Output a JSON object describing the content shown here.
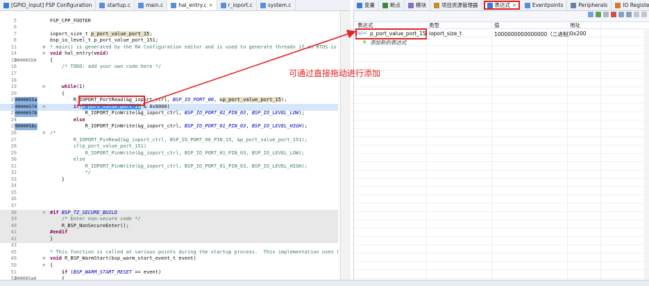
{
  "editor_tabs": [
    "[GPIO_input] FSP Configuration",
    "startup.c",
    "main.c",
    "hal_entry.c",
    "r_ioport.c",
    "system.c"
  ],
  "active_editor_tab": "hal_entry.c",
  "panel_tabs": [
    "变量",
    "断点",
    "模块",
    "项目资源管理器",
    "表达式",
    "Eventpoints",
    "Peripherals",
    "IO Registers"
  ],
  "active_panel_tab": "表达式",
  "expressions": {
    "columns": [
      "表达式",
      "类型",
      "值",
      "地址"
    ],
    "rows": [
      {
        "name": "p_port_value_port_15",
        "type": "ioport_size_t",
        "value": "1000000000000000（二进制）",
        "address": "0x200"
      }
    ],
    "add_new": "添加新的表达式"
  },
  "annotation": "可通过直接拖动进行添加",
  "code": {
    "top_line": "FSP_CPP_FOOTER",
    "lines": [
      {
        "n": "5",
        "addr": "",
        "text": ""
      },
      {
        "n": "6",
        "addr": "",
        "text": ""
      },
      {
        "n": "7",
        "addr": "",
        "text": "ioport_size_t p_port_value_port_15;"
      },
      {
        "n": "8",
        "addr": "",
        "text": "bsp_io_level_t p_port_value_port_151;"
      },
      {
        "n": "11",
        "addr": "",
        "text": "* main() is generated by the RA Configuration editor and is used to generate threads if an RTOS is"
      },
      {
        "n": "14",
        "addr": "",
        "text": "void hal_entry(void)"
      },
      {
        "n": "15",
        "addr": "00000550",
        "text": "{"
      },
      {
        "n": "16",
        "addr": "",
        "text": "    /* TODO: add your own code here */"
      },
      {
        "n": "17",
        "addr": "",
        "text": ""
      },
      {
        "n": "18",
        "addr": "",
        "text": ""
      },
      {
        "n": "19",
        "addr": "",
        "text": "    while(1)"
      },
      {
        "n": "20",
        "addr": "",
        "text": "    {"
      },
      {
        "n": "21",
        "addr": "0000055a",
        "text": "        R_IOPORT_PortRead(&g_ioport_ctrl, BSP_IO_PORT_00, &p_port_value_port_15);"
      },
      {
        "n": "22",
        "addr": "00000570",
        "text": "        if(p_port_value_port_15 & 0x8000)"
      },
      {
        "n": "23",
        "addr": "00000578",
        "text": "            R_IOPORT_PinWrite(&g_ioport_ctrl, BSP_IO_PORT_01_PIN_03, BSP_IO_LEVEL_LOW);"
      },
      {
        "n": "24",
        "addr": "",
        "text": "        else"
      },
      {
        "n": "25",
        "addr": "0000058c",
        "text": "            R_IOPORT_PinWrite(&g_ioport_ctrl, BSP_IO_PORT_01_PIN_03, BSP_IO_LEVEL_HIGH);"
      },
      {
        "n": "26",
        "addr": "",
        "text": "/*"
      },
      {
        "n": "27",
        "addr": "",
        "text": "        R_IOPORT_PinRead(&g_ioport_ctrl, BSP_IO_PORT_00_PIN_15, &p_port_value_port_151);"
      },
      {
        "n": "28",
        "addr": "",
        "text": "        if(p_port_value_port_151)"
      },
      {
        "n": "29",
        "addr": "",
        "text": "            R_IOPORT_PinWrite(&g_ioport_ctrl, BSP_IO_PORT_01_PIN_03, BSP_IO_LEVEL_LOW);"
      },
      {
        "n": "30",
        "addr": "",
        "text": "        else"
      },
      {
        "n": "31",
        "addr": "",
        "text": "            R_IOPORT_PinWrite(&g_ioport_ctrl, BSP_IO_PORT_01_PIN_03, BSP_IO_LEVEL_HIGH);"
      },
      {
        "n": "32",
        "addr": "",
        "text": "            */"
      },
      {
        "n": "33",
        "addr": "",
        "text": "    }"
      },
      {
        "n": "34",
        "addr": "",
        "text": ""
      },
      {
        "n": "35",
        "addr": "",
        "text": ""
      },
      {
        "n": "36",
        "addr": "",
        "text": ""
      },
      {
        "n": "37",
        "addr": "",
        "text": ""
      },
      {
        "n": "38",
        "addr": "",
        "text": "#if BSP_TZ_SECURE_BUILD"
      },
      {
        "n": "39",
        "addr": "",
        "text": "    /* Enter non-secure code */"
      },
      {
        "n": "40",
        "addr": "",
        "text": "    R_BSP_NonSecureEnter();"
      },
      {
        "n": "41",
        "addr": "",
        "text": "#endif"
      },
      {
        "n": "42",
        "addr": "",
        "text": "}"
      },
      {
        "n": "43",
        "addr": "",
        "text": ""
      },
      {
        "n": "45",
        "addr": "",
        "text": "* This function is called at various points during the startup process.  This implementation uses t"
      },
      {
        "n": "49",
        "addr": "",
        "text": "void R_BSP_WarmStart(bsp_warm_start_event_t event)"
      },
      {
        "n": "50",
        "addr": "",
        "text": "{"
      },
      {
        "n": "51",
        "addr": "",
        "text": "    if (BSP_WARM_START_RESET == event)"
      },
      {
        "n": "52",
        "addr": "000005a0",
        "text": "    {"
      },
      {
        "n": "53",
        "addr": "",
        "text": "#if BSP_FEATURE_FLASH_LP_VERSION != 0"
      }
    ]
  },
  "colors": {
    "annotation": "#e82020",
    "keyword": "#7f0055",
    "comment": "#3f7f5f",
    "macro": "#0000c0",
    "selection": "#3399ff"
  }
}
